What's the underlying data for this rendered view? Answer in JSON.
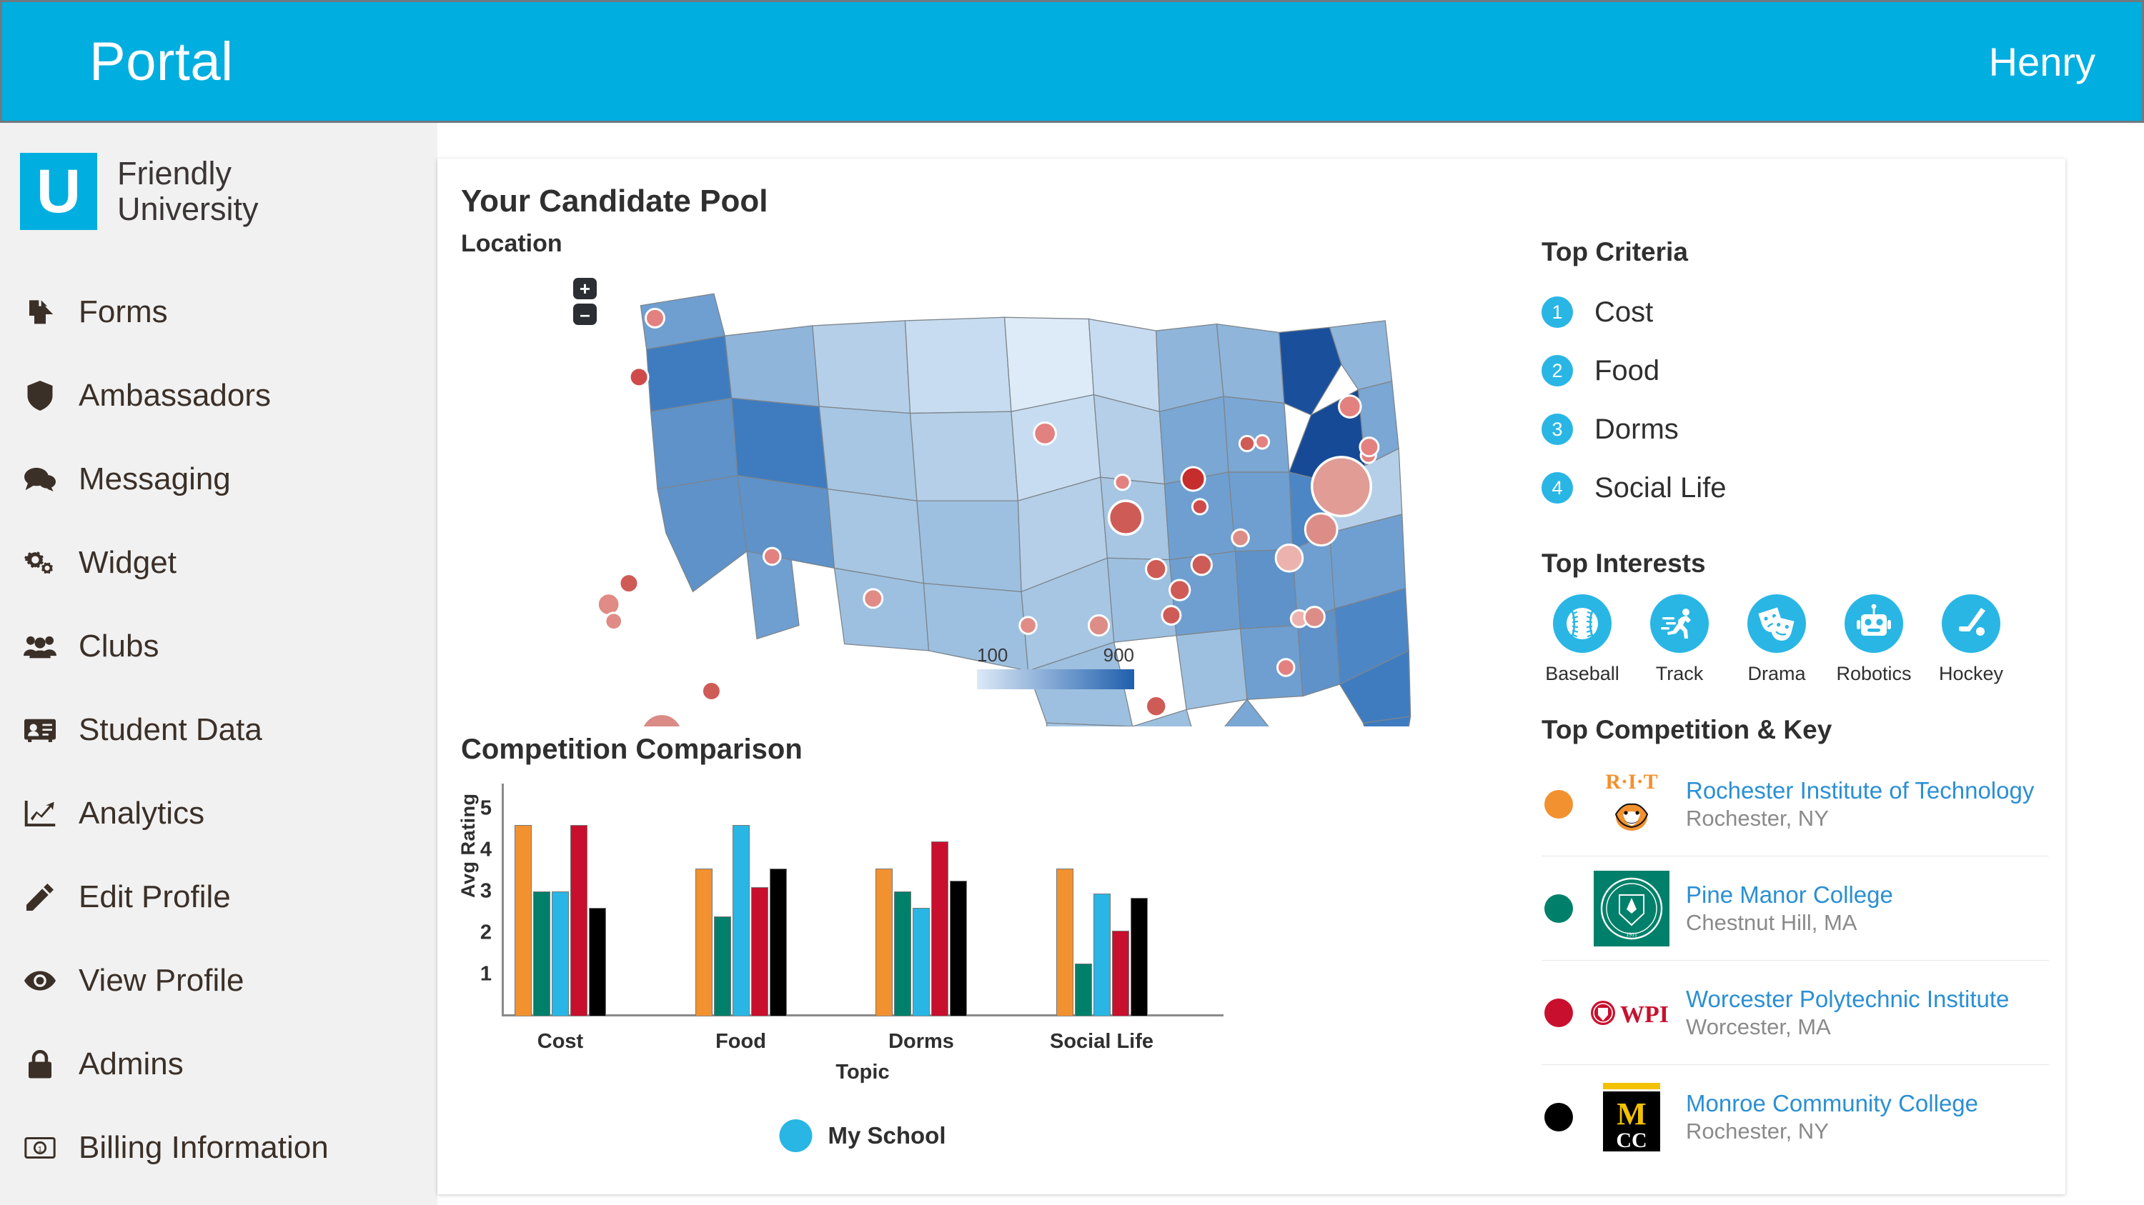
{
  "topbar": {
    "title": "Portal",
    "user": "Henry"
  },
  "brand": {
    "mark": "U",
    "line1": "Friendly",
    "line2": "University"
  },
  "sidebar": {
    "items": [
      {
        "label": "Forms",
        "icon": "forms-icon"
      },
      {
        "label": "Ambassadors",
        "icon": "shield-icon"
      },
      {
        "label": "Messaging",
        "icon": "chat-bubbles-icon"
      },
      {
        "label": "Widget",
        "icon": "gears-icon"
      },
      {
        "label": "Clubs",
        "icon": "users-group-icon"
      },
      {
        "label": "Student Data",
        "icon": "id-card-icon"
      },
      {
        "label": "Analytics",
        "icon": "chart-line-icon"
      },
      {
        "label": "Edit Profile",
        "icon": "pencil-icon"
      },
      {
        "label": "View Profile",
        "icon": "eye-icon"
      },
      {
        "label": "Admins",
        "icon": "lock-icon"
      },
      {
        "label": "Billing Information",
        "icon": "money-bill-icon"
      }
    ]
  },
  "card": {
    "title": "Your Candidate Pool",
    "map_title": "Location",
    "chart_title": "Competition Comparison",
    "zoom_in": "+",
    "zoom_out": "–",
    "map_legend": {
      "min": "100",
      "max": "900",
      "low_color": "#dce9f7",
      "high_color": "#1f5fad"
    }
  },
  "right": {
    "criteria_head": "Top Criteria",
    "criteria": [
      {
        "rank": "1",
        "label": "Cost"
      },
      {
        "rank": "2",
        "label": "Food"
      },
      {
        "rank": "3",
        "label": "Dorms"
      },
      {
        "rank": "4",
        "label": "Social Life"
      }
    ],
    "interests_head": "Top Interests",
    "interests": [
      {
        "label": "Baseball",
        "icon": "baseball-icon"
      },
      {
        "label": "Track",
        "icon": "runner-icon"
      },
      {
        "label": "Drama",
        "icon": "theater-masks-icon"
      },
      {
        "label": "Robotics",
        "icon": "robot-icon"
      },
      {
        "label": "Hockey",
        "icon": "hockey-stick-icon"
      }
    ],
    "competition_head": "Top Competition & Key",
    "competition": [
      {
        "name": "Rochester Institute of Technology",
        "city": "Rochester, NY",
        "color": "#f2912f",
        "logo": "rit-logo"
      },
      {
        "name": "Pine Manor College",
        "city": "Chestnut Hill, MA",
        "color": "#00806a",
        "logo": "pine-manor-logo"
      },
      {
        "name": "Worcester Polytechnic Institute",
        "city": "Worcester, MA",
        "color": "#c8102e",
        "logo": "wpi-logo"
      },
      {
        "name": "Monroe Community College",
        "city": "Rochester, NY",
        "color": "#000000",
        "logo": "mcc-logo"
      }
    ]
  },
  "chart_data": {
    "type": "bar",
    "title": "Competition Comparison",
    "xlabel": "Topic",
    "ylabel": "Avg Rating",
    "categories": [
      "Cost",
      "Food",
      "Dorms",
      "Social Life"
    ],
    "yticks": [
      1,
      2,
      3,
      4,
      5
    ],
    "ylim": [
      0,
      5.6
    ],
    "grid": false,
    "legend": {
      "position": "bottom",
      "entries": [
        {
          "label": "My School",
          "color": "#29b6e5"
        }
      ]
    },
    "series": [
      {
        "name": "Rochester Institute of Technology",
        "color": "#f2912f",
        "values": [
          4.6,
          3.55,
          3.55,
          3.55
        ]
      },
      {
        "name": "Pine Manor College",
        "color": "#00806a",
        "values": [
          3.0,
          2.4,
          3.0,
          1.25
        ]
      },
      {
        "name": "My School",
        "color": "#29b6e5",
        "values": [
          3.0,
          4.6,
          2.6,
          2.95
        ]
      },
      {
        "name": "Worcester Polytechnic Institute",
        "color": "#c8102e",
        "values": [
          4.6,
          3.1,
          4.2,
          2.05
        ]
      },
      {
        "name": "Monroe Community College",
        "color": "#000000",
        "values": [
          2.6,
          3.55,
          3.25,
          2.85
        ]
      }
    ]
  },
  "map_data": {
    "type": "choropleth-bubble",
    "region": "United States",
    "legend_min": 100,
    "legend_max": 900
  }
}
